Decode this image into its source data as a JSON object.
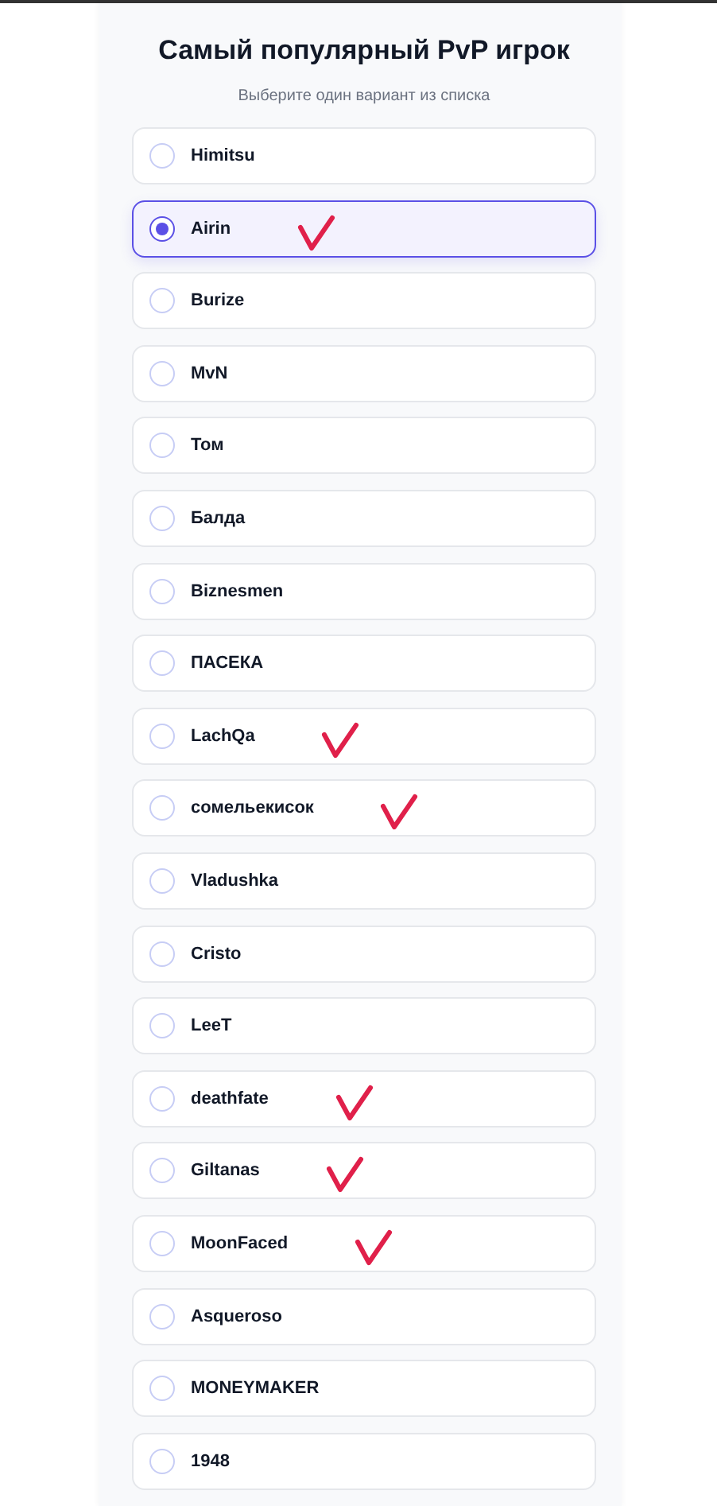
{
  "title": "Самый популярный PvP игрок",
  "subtitle": "Выберите один вариант из списка",
  "options": [
    {
      "label": "Himitsu",
      "selected": false,
      "marked": false
    },
    {
      "label": "Airin",
      "selected": true,
      "marked": true
    },
    {
      "label": "Burize",
      "selected": false,
      "marked": false
    },
    {
      "label": "MvN",
      "selected": false,
      "marked": false
    },
    {
      "label": "Том",
      "selected": false,
      "marked": false
    },
    {
      "label": "Балда",
      "selected": false,
      "marked": false
    },
    {
      "label": "Biznesmen",
      "selected": false,
      "marked": false
    },
    {
      "label": "ПАСЕКА",
      "selected": false,
      "marked": false
    },
    {
      "label": "LachQa",
      "selected": false,
      "marked": true
    },
    {
      "label": "сомельекисок",
      "selected": false,
      "marked": true
    },
    {
      "label": "Vladushka",
      "selected": false,
      "marked": false
    },
    {
      "label": "Cristo",
      "selected": false,
      "marked": false
    },
    {
      "label": "LeeT",
      "selected": false,
      "marked": false
    },
    {
      "label": "deathfate",
      "selected": false,
      "marked": true
    },
    {
      "label": "Giltanas",
      "selected": false,
      "marked": true
    },
    {
      "label": "MoonFaced",
      "selected": false,
      "marked": true
    },
    {
      "label": "Asqueroso",
      "selected": false,
      "marked": false
    },
    {
      "label": "MONEYMAKER",
      "selected": false,
      "marked": false
    },
    {
      "label": "1948",
      "selected": false,
      "marked": false
    }
  ]
}
